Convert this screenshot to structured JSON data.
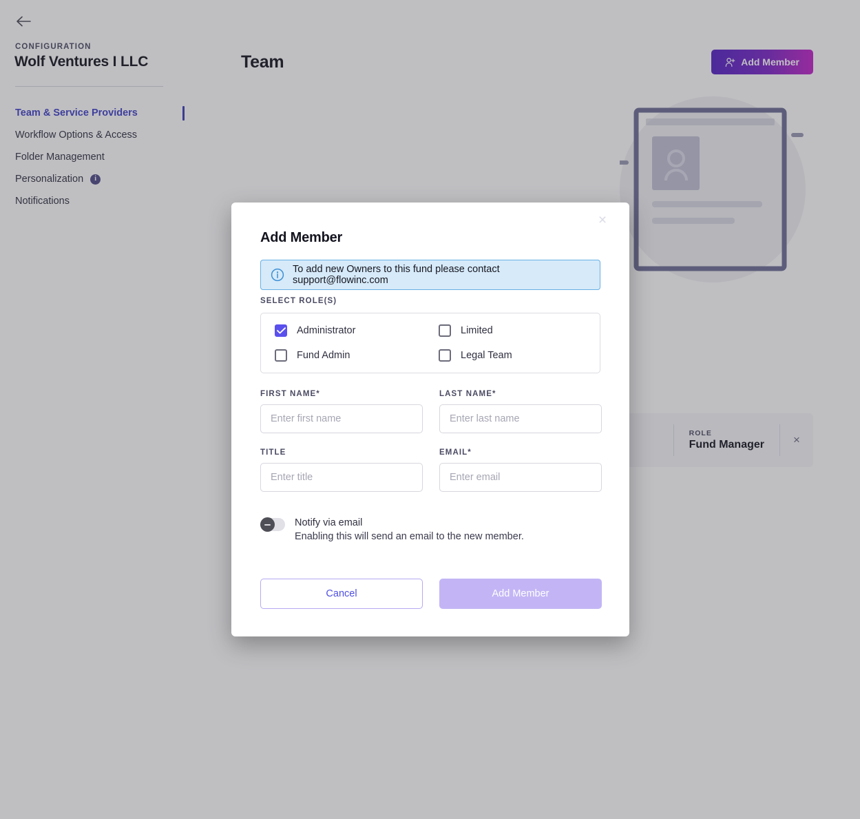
{
  "sidebar": {
    "back_icon": "arrow-left-icon",
    "eyebrow": "CONFIGURATION",
    "title": "Wolf Ventures I LLC",
    "items": [
      {
        "label": "Team & Service Providers",
        "active": true
      },
      {
        "label": "Workflow Options & Access",
        "active": false
      },
      {
        "label": "Folder Management",
        "active": false
      },
      {
        "label": "Personalization",
        "active": false,
        "info": "i"
      },
      {
        "label": "Notifications",
        "active": false
      }
    ]
  },
  "main": {
    "page_title": "Team",
    "add_member_button": "Add Member",
    "add_member_icon": "user-plus-icon",
    "member_row": {
      "role_label": "ROLE",
      "role_value": "Fund Manager",
      "remove_icon": "×"
    }
  },
  "modal": {
    "close_icon": "×",
    "title": "Add Member",
    "info_banner": {
      "icon": "info-circle-icon",
      "text": "To add new Owners to this fund please contact support@flowinc.com"
    },
    "roles_label": "SELECT ROLE(S)",
    "roles": [
      {
        "label": "Administrator",
        "checked": true
      },
      {
        "label": "Limited",
        "checked": false
      },
      {
        "label": "Fund Admin",
        "checked": false
      },
      {
        "label": "Legal Team",
        "checked": false
      }
    ],
    "fields": {
      "first_name": {
        "label": "FIRST NAME*",
        "value": "",
        "placeholder": "Enter first name"
      },
      "last_name": {
        "label": "LAST NAME*",
        "value": "",
        "placeholder": "Enter last name"
      },
      "title": {
        "label": "TITLE",
        "value": "",
        "placeholder": "Enter title"
      },
      "email": {
        "label": "EMAIL*",
        "value": "",
        "placeholder": "Enter email"
      }
    },
    "notify": {
      "enabled": false,
      "title": "Notify via email",
      "description": "Enabling this will send an email to the new member."
    },
    "cancel_button": "Cancel",
    "submit_button": "Add Member"
  },
  "colors": {
    "accent_purple": "#5a50ee",
    "link_purple": "#4f4fe0",
    "submit_disabled": "#c3b5f5",
    "banner_bg": "#d6eaf9",
    "banner_border": "#68afe3",
    "gradient_start": "#5321c4",
    "gradient_end": "#c323c8",
    "scrim": "rgba(60,60,70,0.33)"
  }
}
